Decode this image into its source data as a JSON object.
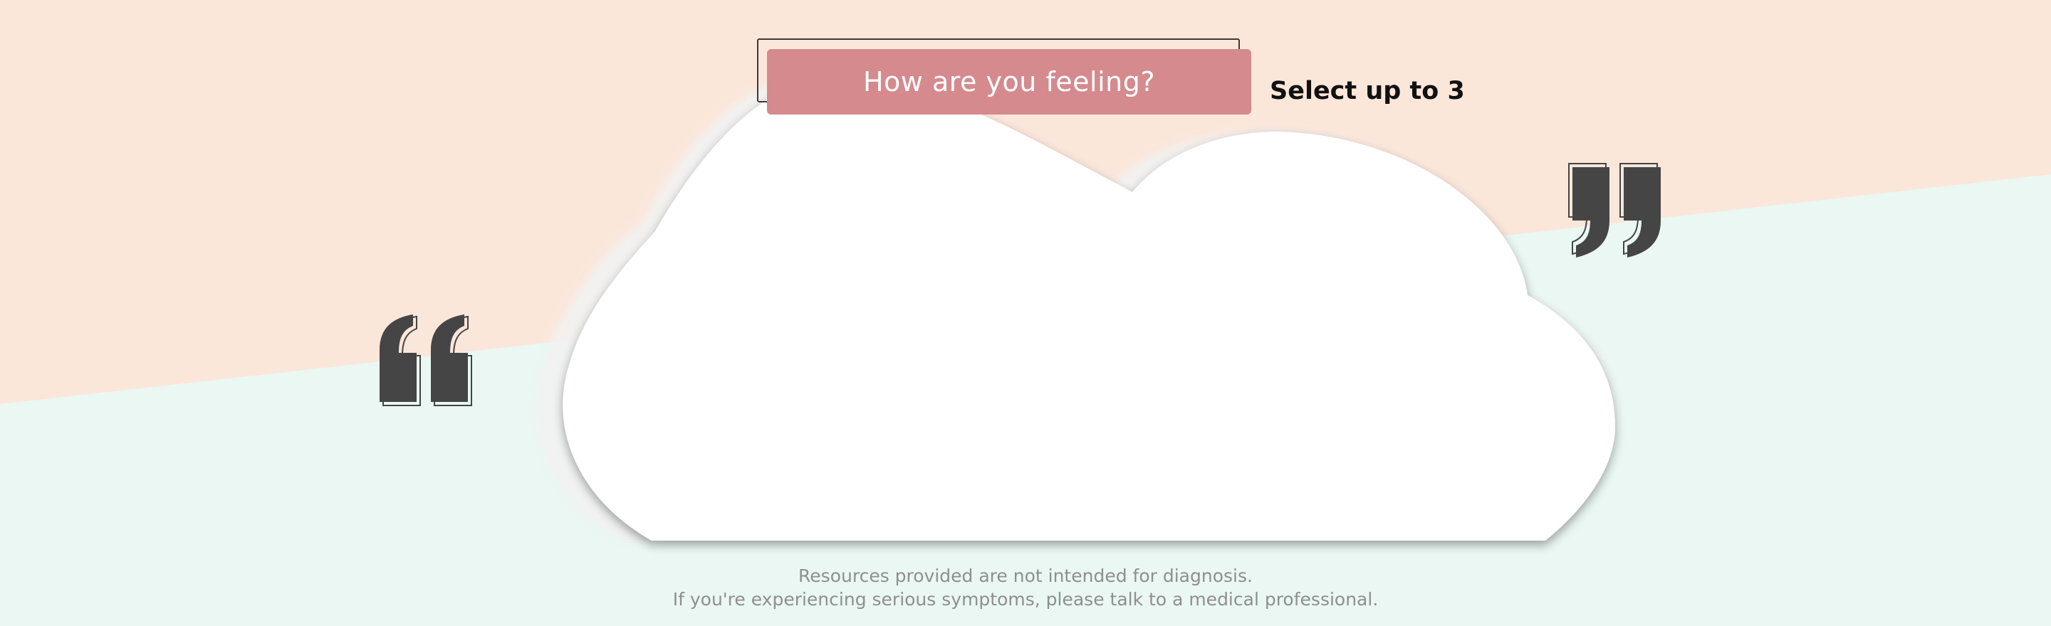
{
  "question": "How are you feeling?",
  "hint": "Select up to 3",
  "disclaimer": {
    "line1": "Resources provided are not intended for diagnosis.",
    "line2": "If you're experiencing serious symptoms, please talk to a medical professional."
  },
  "colors": {
    "top_background": "#fbe6da",
    "bottom_background": "#eaf7f2",
    "title_fill": "#d58a8d",
    "quote_mark": "#454545",
    "cloud": "#ffffff"
  },
  "icons": {
    "open_quote": "open-quote-icon",
    "close_quote": "close-quote-icon",
    "cloud": "cloud-shape"
  }
}
